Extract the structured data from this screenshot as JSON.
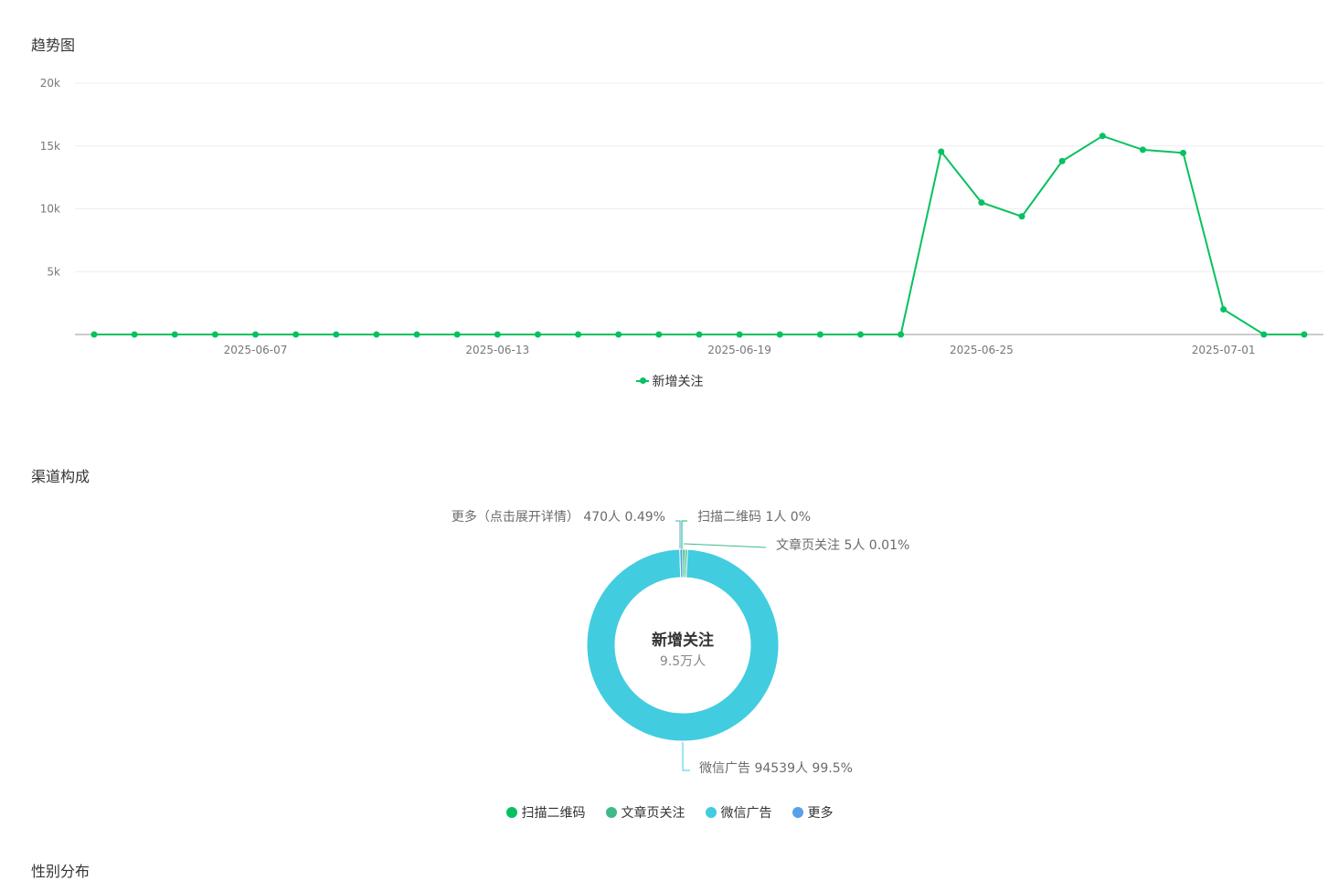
{
  "sections": {
    "trend_title": "趋势图",
    "channel_title": "渠道构成",
    "cut_text": "性别分布"
  },
  "colors": {
    "line": "#07c160",
    "grid": "#eeeeee",
    "axis": "#cccccc",
    "tick": "#777777"
  },
  "chart_data": [
    {
      "type": "line",
      "title": "趋势图",
      "x_tick_labels": [
        "2025-06-07",
        "2025-06-13",
        "2025-06-19",
        "2025-06-25",
        "2025-07-01"
      ],
      "x": [
        "2025-06-03",
        "2025-06-04",
        "2025-06-05",
        "2025-06-06",
        "2025-06-07",
        "2025-06-08",
        "2025-06-09",
        "2025-06-10",
        "2025-06-11",
        "2025-06-12",
        "2025-06-13",
        "2025-06-14",
        "2025-06-15",
        "2025-06-16",
        "2025-06-17",
        "2025-06-18",
        "2025-06-19",
        "2025-06-20",
        "2025-06-21",
        "2025-06-22",
        "2025-06-23",
        "2025-06-24",
        "2025-06-25",
        "2025-06-26",
        "2025-06-27",
        "2025-06-28",
        "2025-06-29",
        "2025-06-30",
        "2025-07-01",
        "2025-07-02",
        "2025-07-03"
      ],
      "y_tick_labels": [
        "5k",
        "10k",
        "15k",
        "20k"
      ],
      "ylim": [
        0,
        20000
      ],
      "grid": true,
      "legend_position": "bottom-center",
      "series": [
        {
          "name": "新增关注",
          "values": [
            0,
            0,
            0,
            0,
            0,
            0,
            0,
            0,
            0,
            0,
            0,
            0,
            0,
            0,
            0,
            0,
            0,
            0,
            0,
            0,
            0,
            14550,
            10500,
            9400,
            13800,
            15800,
            14700,
            14450,
            2000,
            0,
            0
          ]
        }
      ]
    },
    {
      "type": "pie",
      "title": "渠道构成",
      "center_label": "新增关注",
      "center_value": "9.5万人",
      "legend_position": "bottom-center",
      "slices": [
        {
          "name": "扫描二维码",
          "value": 1,
          "label": "扫描二维码 1人 0%",
          "color": "#07c160"
        },
        {
          "name": "文章页关注",
          "value": 5,
          "label": "文章页关注 5人 0.01%",
          "color": "#3dba8a"
        },
        {
          "name": "微信广告",
          "value": 94539,
          "label": "微信广告 94539人 99.5%",
          "color": "#42cce0"
        },
        {
          "name": "更多",
          "value": 470,
          "label": "更多（点击展开详情） 470人 0.49%",
          "color": "#5aa0e6"
        }
      ]
    }
  ]
}
